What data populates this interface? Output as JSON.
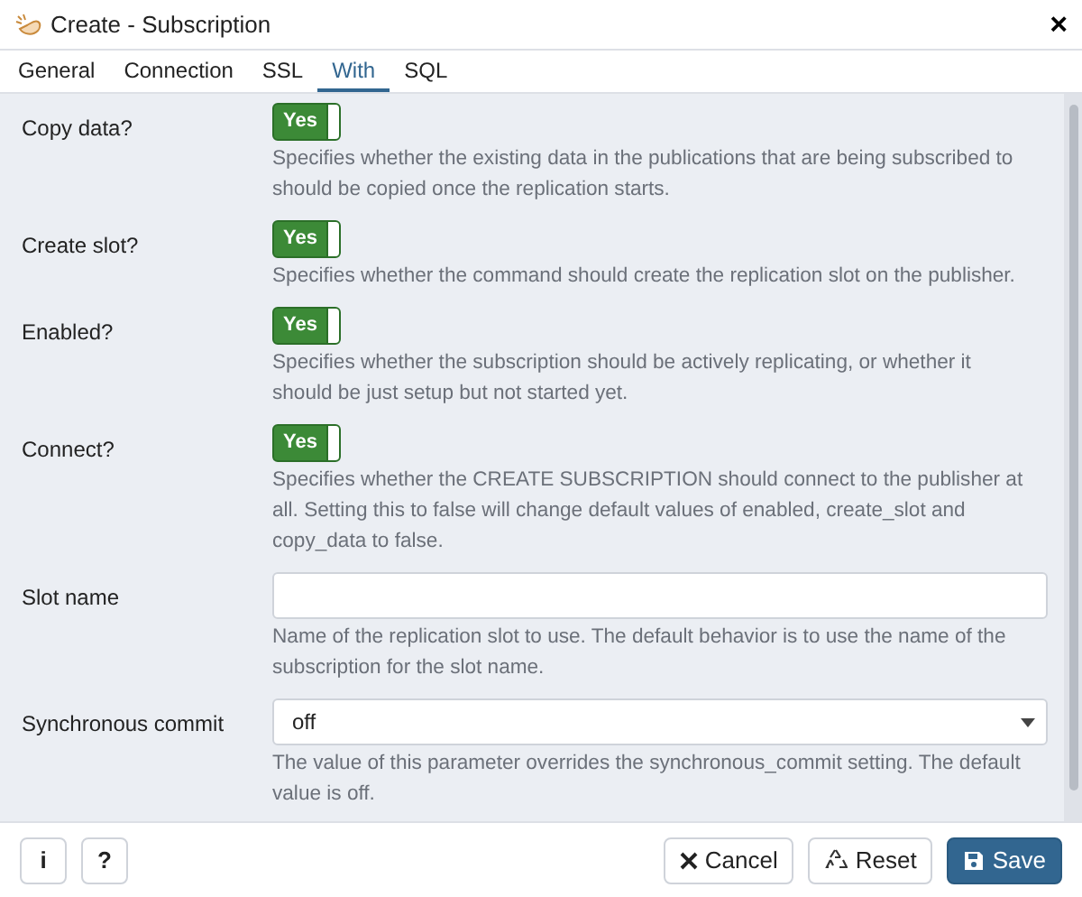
{
  "window": {
    "title": "Create - Subscription",
    "close": "×"
  },
  "tabs": [
    {
      "label": "General",
      "selected": false
    },
    {
      "label": "Connection",
      "selected": false
    },
    {
      "label": "SSL",
      "selected": false
    },
    {
      "label": "With",
      "selected": true
    },
    {
      "label": "SQL",
      "selected": false
    }
  ],
  "fields": [
    {
      "kind": "toggle",
      "label": "Copy data?",
      "on": true,
      "value": "Yes",
      "help": "Specifies whether the existing data in the publications that are being subscribed to should be copied once the replication starts."
    },
    {
      "kind": "toggle",
      "label": "Create slot?",
      "on": true,
      "value": "Yes",
      "help": "Specifies whether the command should create the replication slot on the publisher."
    },
    {
      "kind": "toggle",
      "label": "Enabled?",
      "on": true,
      "value": "Yes",
      "help": "Specifies whether the subscription should be actively replicating, or whether it should be just setup but not started yet."
    },
    {
      "kind": "toggle",
      "label": "Connect?",
      "on": true,
      "value": "Yes",
      "help": "Specifies whether the CREATE SUBSCRIPTION should connect to the publisher at all. Setting this to false will change default values of enabled, create_slot and copy_data to false."
    },
    {
      "kind": "text",
      "label": "Slot name",
      "help": "Name of the replication slot to use. The default behavior is to use the name of the subscription for the slot name."
    },
    {
      "kind": "select",
      "label": "Synchronous commit",
      "value": "off",
      "help": "The value of this parameter overrides the synchronous_commit setting. The default value is off."
    }
  ],
  "footer": {
    "left": [
      "i",
      "?"
    ],
    "buttons": [
      {
        "kind": "cancel",
        "label": "Cancel"
      },
      {
        "kind": "reset",
        "label": "Reset"
      },
      {
        "kind": "save",
        "label": "Save"
      }
    ]
  }
}
